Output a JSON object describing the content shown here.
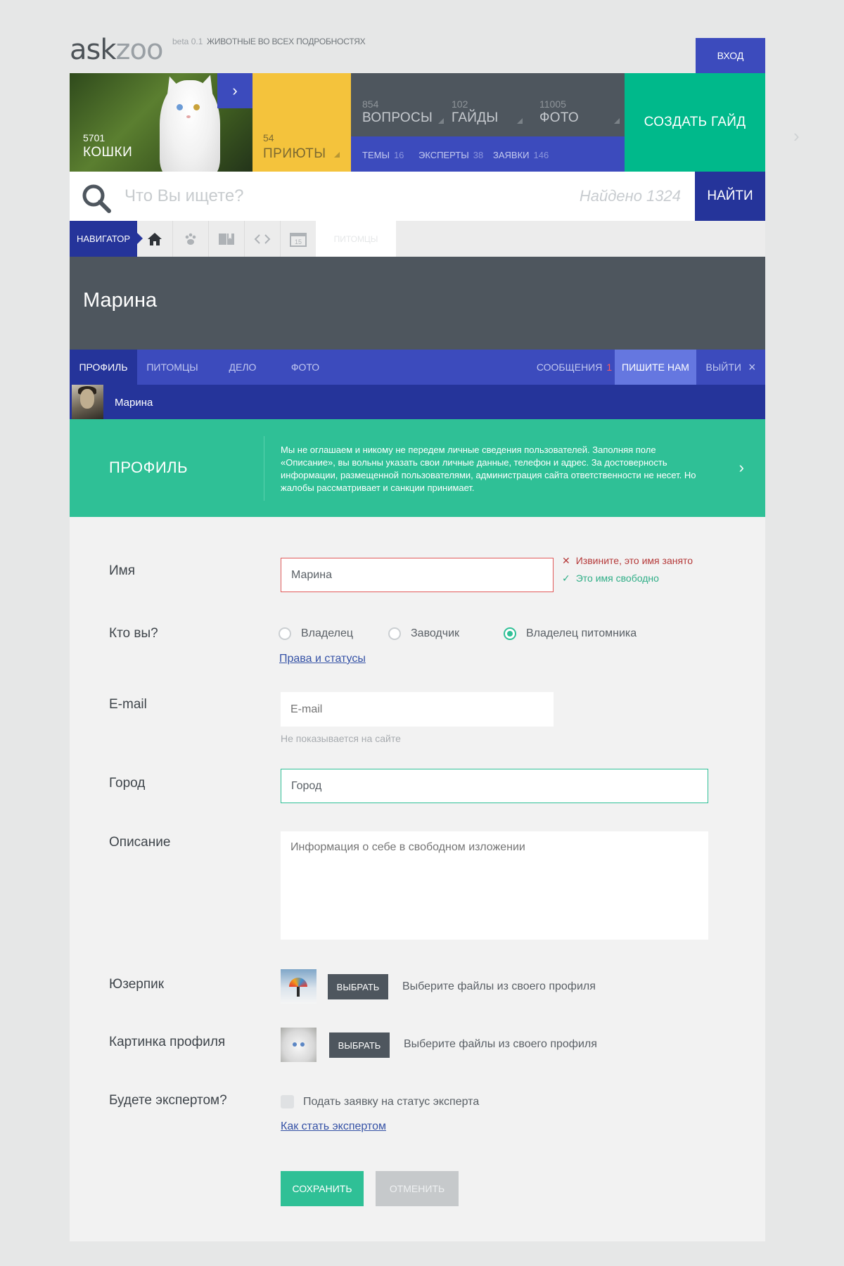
{
  "header": {
    "logo_ask": "ask",
    "logo_zoo": "zoo",
    "beta": "beta 0.1",
    "tagline": "ЖИВОТНЫЕ ВО ВСЕХ ПОДРОБНОСТЯХ",
    "login_label": "ВХОД"
  },
  "tiles": {
    "cats": {
      "count": "5701",
      "label": "КОШКИ",
      "arrow": "›"
    },
    "shelters": {
      "count": "54",
      "label": "ПРИЮТЫ"
    },
    "stats": [
      {
        "count": "854",
        "label": "ВОПРОСЫ"
      },
      {
        "count": "102",
        "label": "ГАЙДЫ"
      },
      {
        "count": "11005",
        "label": "ФОТО"
      }
    ],
    "sub": [
      {
        "label": "ТЕМЫ",
        "count": "16"
      },
      {
        "label": "ЭКСПЕРТЫ",
        "count": "38"
      },
      {
        "label": "ЗАЯВКИ",
        "count": "146"
      }
    ],
    "create_guide": "СОЗДАТЬ ГАЙД"
  },
  "search": {
    "placeholder": "Что Вы ищете?",
    "found": "Найдено 1324",
    "button": "НАЙТИ"
  },
  "navigator": {
    "label": "НАВИГАТОР",
    "icons": [
      "home-icon",
      "paw-icon",
      "book-icon",
      "code-icon",
      "calendar-icon"
    ],
    "calendar_day": "15",
    "pets_tab": "ПИТОМЦЫ"
  },
  "user": {
    "name": "Марина",
    "strip_name": "Марина"
  },
  "tabs": {
    "profile": "ПРОФИЛЬ",
    "pets": "ПИТОМЦЫ",
    "case": "ДЕЛО",
    "photo": "ФОТО",
    "messages": "СООБЩЕНИЯ",
    "messages_count": "1",
    "write_us": "ПИШИТЕ НАМ",
    "logout": "ВЫЙТИ",
    "logout_icon": "×"
  },
  "banner": {
    "title": "ПРОФИЛЬ",
    "text": "Мы не оглашаем и никому не передем личные сведения пользователей. Заполняя поле «Описание», вы вольны указать свои личные данные, телефон и адрес. За достоверность информации, размещенной пользователями, администрация сайта ответственности не несет. Но жалобы рассматривает и санкции принимает.",
    "arrow": "›"
  },
  "form": {
    "name_label": "Имя",
    "name_value": "Марина",
    "name_error": "Извините, это имя занято",
    "name_ok": "Это имя свободно",
    "who_label": "Кто вы?",
    "who_options": [
      "Владелец",
      "Заводчик",
      "Владелец питомника"
    ],
    "who_selected": "Владелец питомника",
    "rights_link": "Права и статусы",
    "email_label": "E-mail",
    "email_placeholder": "E-mail",
    "email_note": "Не показывается на сайте",
    "city_label": "Город",
    "city_value": "Город",
    "desc_label": "Описание",
    "desc_placeholder": "Информация о себе в свободном изложении",
    "userpic_label": "Юзерпик",
    "pick_label": "ВЫБРАТЬ",
    "pick_text": "Выберите файлы из своего профиля",
    "profile_pic_label": "Картинка профиля",
    "expert_label": "Будете экспертом?",
    "expert_checkbox": "Подать заявку на статус эксперта",
    "expert_link": "Как стать экспертом",
    "save": "СОХРАНИТЬ",
    "cancel": "ОТМЕНИТЬ"
  },
  "colors": {
    "blue": "#3c4bbd",
    "dark_blue": "#25349a",
    "green": "#2fc096",
    "yellow": "#f4c33c",
    "slate": "#4e565e",
    "teal": "#00b98b"
  }
}
